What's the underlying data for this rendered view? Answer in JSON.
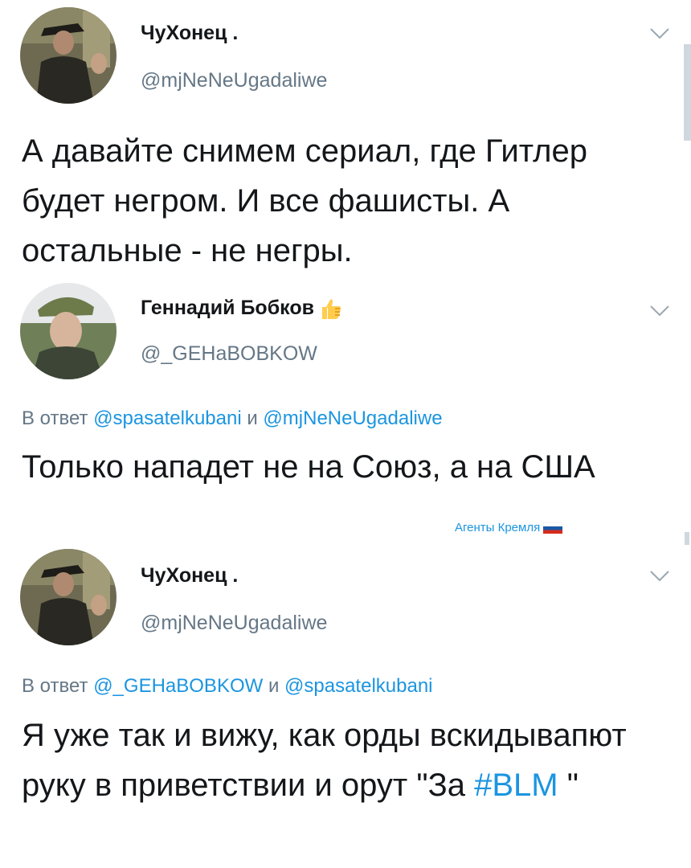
{
  "tweets": [
    {
      "author": {
        "name": "ЧуХонец .",
        "handle": "@mjNeNeUgadaliwe"
      },
      "reply": null,
      "text": "А давайте снимем сериал, где Гитлер будет негром. И все фашисты. А остальные - не негры."
    },
    {
      "author": {
        "name": "Геннадий Бобков",
        "handle": "@_GEHaBOBKOW",
        "emoji": "thumbs-up-icon"
      },
      "reply": {
        "prefix": "В ответ",
        "mention1": "@spasatelkubani",
        "conj": "и",
        "mention2": "@mjNeNeUgadaliwe"
      },
      "text": "Только нападет не на Союз, а на США"
    },
    {
      "author": {
        "name": "ЧуХонец .",
        "handle": "@mjNeNeUgadaliwe"
      },
      "reply": {
        "prefix": "В ответ",
        "mention1": "@_GEHaBOBKOW",
        "conj": "и",
        "mention2": "@spasatelkubani"
      },
      "text_before": "Я уже так и вижу, как орды вскидывапют руку в приветствии и орут \"За ",
      "hashtag": "#BLM",
      "text_after": " \""
    }
  ],
  "watermark": {
    "text": "Агенты Кремля",
    "icon": "russian-flag-icon"
  },
  "colors": {
    "accent": "#1b95e0",
    "secondary_text": "#657786",
    "primary_text": "#14171a"
  }
}
